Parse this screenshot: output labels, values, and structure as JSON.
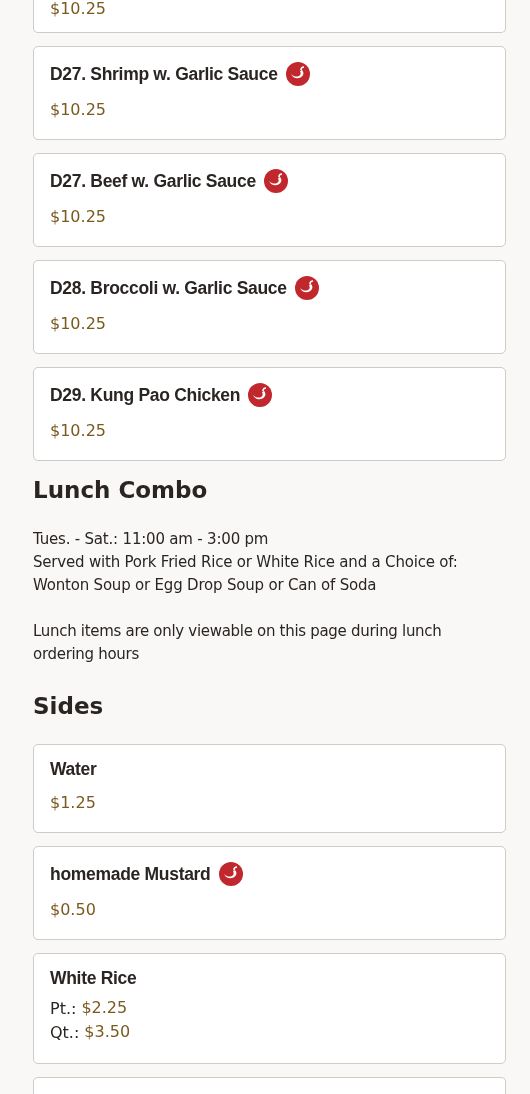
{
  "sections": [
    {
      "kind": "items",
      "items": [
        {
          "price": "$10.25",
          "clipped": true
        },
        {
          "name": "D27. Shrimp w. Garlic Sauce",
          "spicy": true,
          "price": "$10.25"
        },
        {
          "name": "D27. Beef w. Garlic Sauce",
          "spicy": true,
          "price": "$10.25"
        },
        {
          "name": "D28. Broccoli w. Garlic Sauce",
          "spicy": true,
          "price": "$10.25"
        },
        {
          "name": "D29. Kung Pao Chicken",
          "spicy": true,
          "price": "$10.25"
        }
      ]
    },
    {
      "kind": "info",
      "title": "Lunch Combo",
      "lines": [
        "Tues. - Sat.: 11:00 am - 3:00 pm",
        "Served with Pork Fried Rice or White Rice and a Choice of: Wonton Soup or Egg Drop Soup or Can of Soda"
      ],
      "note": "Lunch items are only viewable on this page during lunch ordering hours"
    },
    {
      "kind": "items",
      "title": "Sides",
      "items": [
        {
          "name": "Water",
          "spicy": false,
          "price": "$1.25"
        },
        {
          "name": "homemade Mustard",
          "spicy": true,
          "price": "$0.50"
        },
        {
          "name": "White Rice",
          "spicy": false,
          "sizes": [
            {
              "label": "Pt.:",
              "price": "$2.25"
            },
            {
              "label": "Qt.:",
              "price": "$3.50"
            }
          ]
        },
        {
          "stub": true
        }
      ]
    }
  ]
}
